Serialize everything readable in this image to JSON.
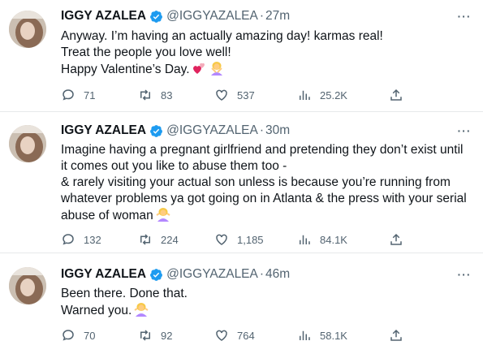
{
  "colors": {
    "text": "#0f1419",
    "secondary": "#536471",
    "verified": "#1d9bf0",
    "divider": "#e7e9ea"
  },
  "tweets": [
    {
      "name": "IGGY AZALEA",
      "handle": "@IGGYAZALEA",
      "dot": "·",
      "time": "27m",
      "lines": [
        "Anyway. I’m having an actually amazing day! karmas real!",
        "Treat the people you love well!",
        "Happy Valentine’s Day."
      ],
      "emojis": [
        "two-hearts-emoji",
        "person-gesturing-no-emoji"
      ],
      "counts": {
        "reply": "71",
        "retweet": "83",
        "like": "537",
        "views": "25.2K"
      }
    },
    {
      "name": "IGGY AZALEA",
      "handle": "@IGGYAZALEA",
      "dot": "·",
      "time": "30m",
      "lines": [
        "Imagine having a pregnant girlfriend and pretending they don’t exist until",
        "it comes out you like to abuse them too -",
        "& rarely visiting your actual son unless is because you’re running from",
        "whatever problems ya got going on in Atlanta & the press with your serial",
        "abuse of woman"
      ],
      "emojis": [
        "person-shrugging-emoji"
      ],
      "counts": {
        "reply": "132",
        "retweet": "224",
        "like": "1,185",
        "views": "84.1K"
      }
    },
    {
      "name": "IGGY AZALEA",
      "handle": "@IGGYAZALEA",
      "dot": "·",
      "time": "46m",
      "lines": [
        "Been there. Done that.",
        "Warned you."
      ],
      "emojis": [
        "person-shrugging-emoji"
      ],
      "counts": {
        "reply": "70",
        "retweet": "92",
        "like": "764",
        "views": "58.1K"
      }
    }
  ]
}
